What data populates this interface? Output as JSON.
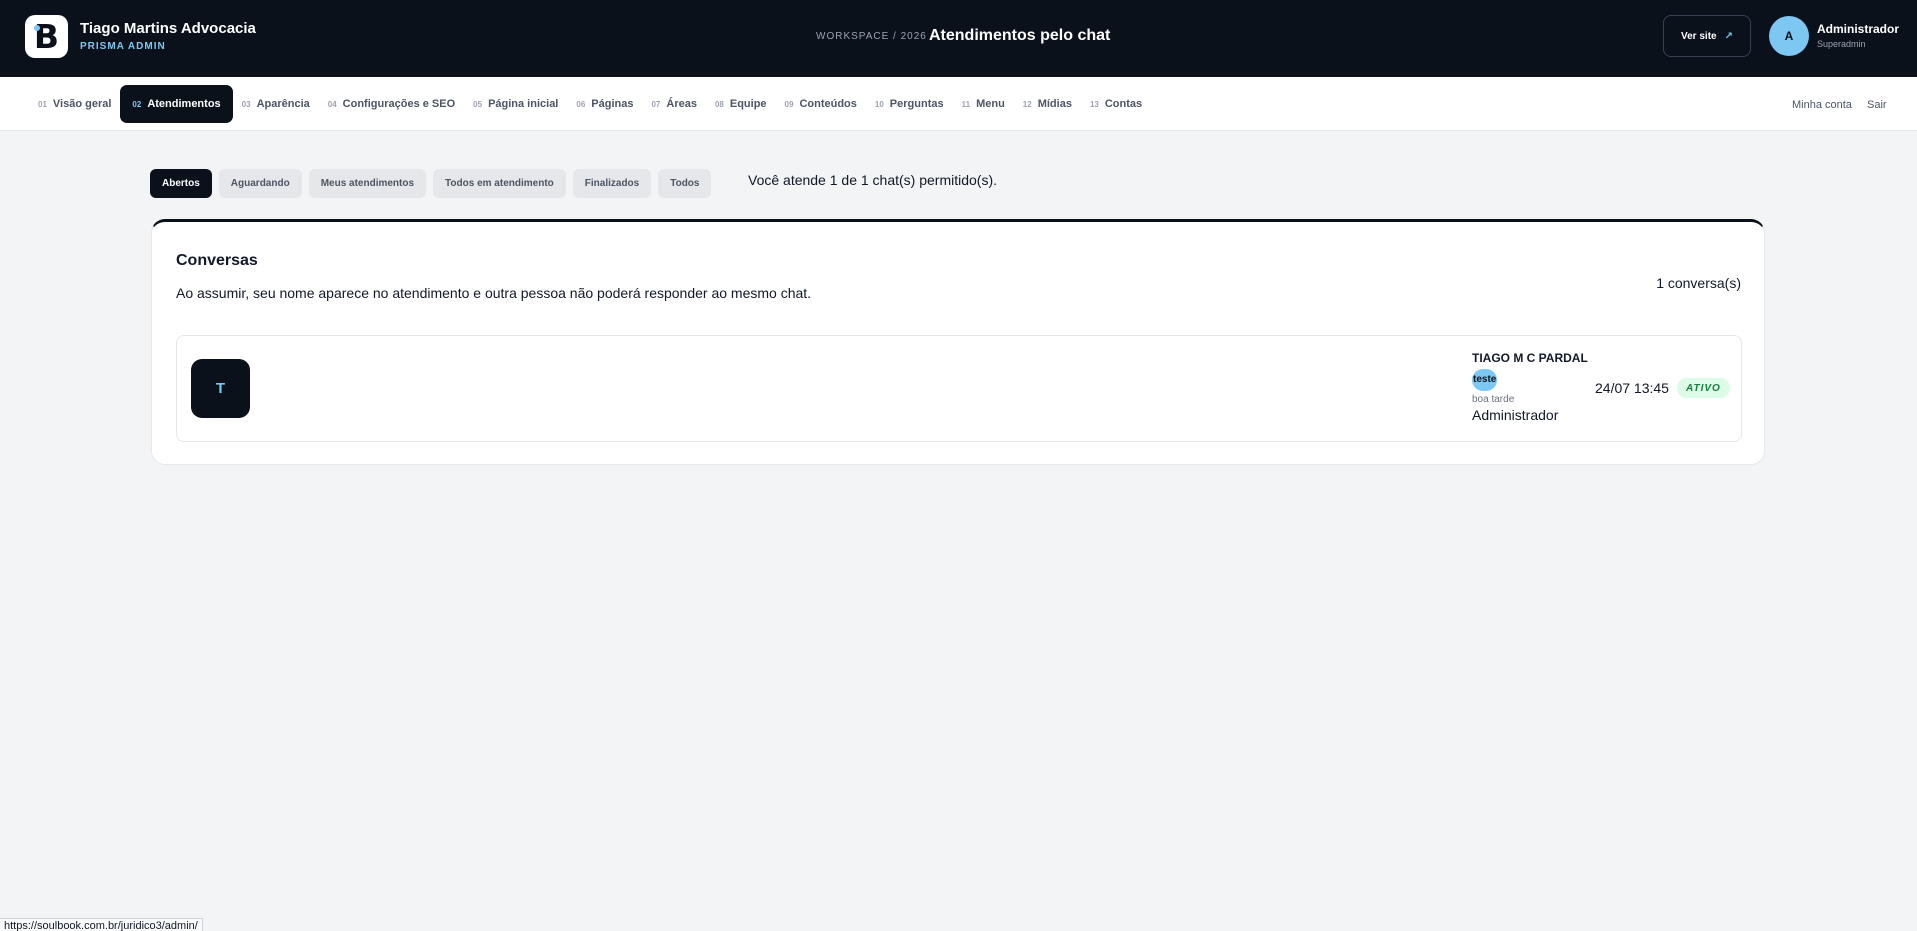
{
  "header": {
    "brand_name": "Tiago Martins Advocacia",
    "brand_sub": "PRISMA ADMIN",
    "logo_letter": "B",
    "workspace": "WORKSPACE / 2026",
    "title": "Atendimentos pelo chat",
    "ver_site": "Ver site",
    "ver_site_icon": "↗",
    "user_initial": "A",
    "user_name": "Administrador",
    "user_role": "Superadmin"
  },
  "nav": {
    "items": [
      {
        "num": "01",
        "label": "Visão geral"
      },
      {
        "num": "02",
        "label": "Atendimentos"
      },
      {
        "num": "03",
        "label": "Aparência"
      },
      {
        "num": "04",
        "label": "Configurações e SEO"
      },
      {
        "num": "05",
        "label": "Página inicial"
      },
      {
        "num": "06",
        "label": "Páginas"
      },
      {
        "num": "07",
        "label": "Áreas"
      },
      {
        "num": "08",
        "label": "Equipe"
      },
      {
        "num": "09",
        "label": "Conteúdos"
      },
      {
        "num": "10",
        "label": "Perguntas"
      },
      {
        "num": "11",
        "label": "Menu"
      },
      {
        "num": "12",
        "label": "Mídias"
      },
      {
        "num": "13",
        "label": "Contas"
      }
    ],
    "account": "Minha conta",
    "logout": "Sair"
  },
  "filters": {
    "items": [
      "Abertos",
      "Aguardando",
      "Meus atendimentos",
      "Todos em atendimento",
      "Finalizados",
      "Todos"
    ],
    "note": "Você atende 1 de 1 chat(s) permitido(s)."
  },
  "conversations": {
    "title": "Conversas",
    "description": "Ao assumir, seu nome aparece no atendimento e outra pessoa não poderá responder ao mesmo chat.",
    "count": "1 conversa(s)",
    "items": [
      {
        "initial": "T",
        "name": "TIAGO M C PARDAL",
        "tag": "teste",
        "last_message": "boa tarde",
        "agent": "Administrador",
        "time": "24/07 13:45",
        "status": "ATIVO"
      }
    ]
  },
  "status_bar_url": "https://soulbook.com.br/juridico3/admin/",
  "colors": {
    "dark": "#0b111b",
    "accent": "#7cc8f3",
    "status_active_bg": "#dcfce7",
    "status_active_text": "#15803d"
  }
}
